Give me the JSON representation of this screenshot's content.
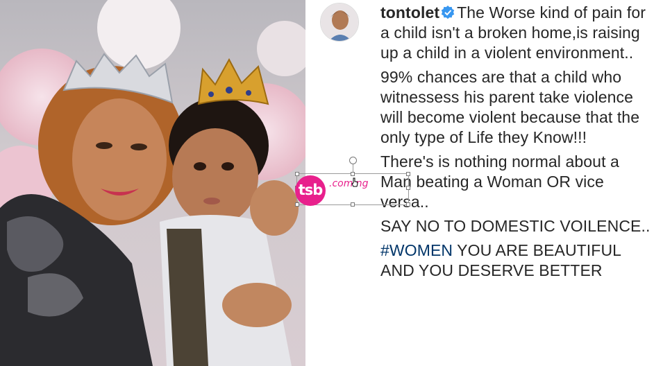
{
  "post": {
    "username": "tontolet",
    "verified_icon": "verified-badge-icon",
    "paragraphs": [
      "The Worse kind of pain for a child isn't a broken home,is raising up a child in a violent environment..",
      "99% chances are that a child who witnessess his parent take violence will become violent because that the only type of Life they Know!!!",
      "There's is nothing normal about a Man beating a Woman OR vice versa..",
      "SAY NO TO DOMESTIC VOILENCE.."
    ],
    "hashtag": "#WOMEN",
    "closing": " YOU ARE BEAUTIFUL AND YOU DESERVE BETTER"
  },
  "watermark": {
    "logo": "tsb",
    "text": ".com.ng"
  },
  "colors": {
    "text": "#262626",
    "hashtag": "#003569",
    "verified": "#3897f0",
    "watermark": "#e8208c"
  }
}
